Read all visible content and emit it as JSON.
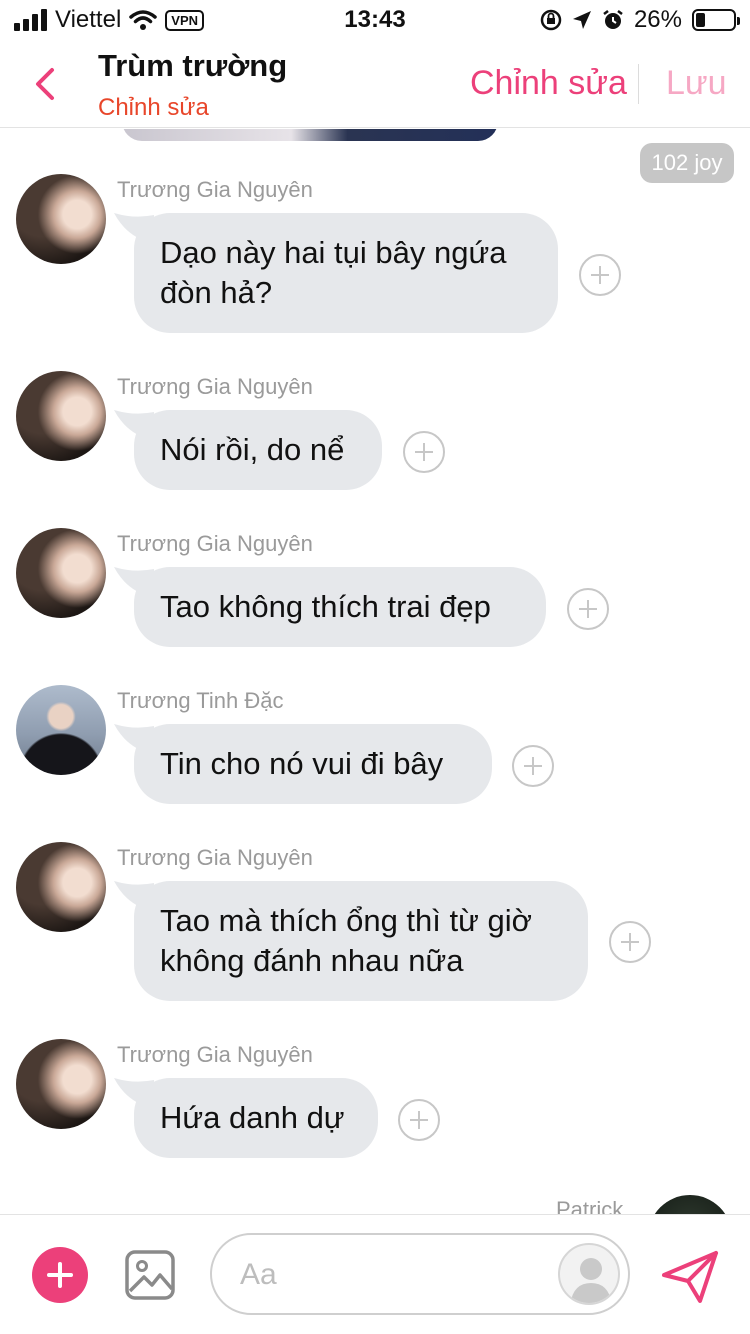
{
  "status_bar": {
    "carrier": "Viettel",
    "vpn": "VPN",
    "time": "13:43",
    "battery_percent": "26%",
    "battery_level": 0.26
  },
  "header": {
    "title": "Trùm trường",
    "subtitle": "Chỉnh sửa",
    "edit_label": "Chỉnh sửa",
    "save_label": "Lưu",
    "accent_color": "#ec407a"
  },
  "chat": {
    "joy_badge": "102 joy",
    "messages": [
      {
        "sender": "Trương Gia Nguyên",
        "text": "Dạo này hai tụi bây ngứa đòn hả?"
      },
      {
        "sender": "Trương Gia Nguyên",
        "text": "Nói rồi, do nể"
      },
      {
        "sender": "Trương Gia Nguyên",
        "text": "Tao không thích trai đẹp"
      },
      {
        "sender": "Trương Tinh Đặc",
        "text": "Tin cho nó vui đi bây"
      },
      {
        "sender": "Trương Gia Nguyên",
        "text": "Tao mà thích ổng thì từ giờ không đánh nhau nữa"
      },
      {
        "sender": "Trương Gia Nguyên",
        "text": "Hứa danh dự"
      }
    ],
    "next_sender": "Patrick"
  },
  "composer": {
    "placeholder": "Aa"
  },
  "icons": {
    "back": "chevron-left-icon",
    "add": "plus-icon",
    "image": "image-icon",
    "mask": "mask-avatar-icon",
    "send": "send-icon",
    "react": "add-reaction-icon"
  }
}
